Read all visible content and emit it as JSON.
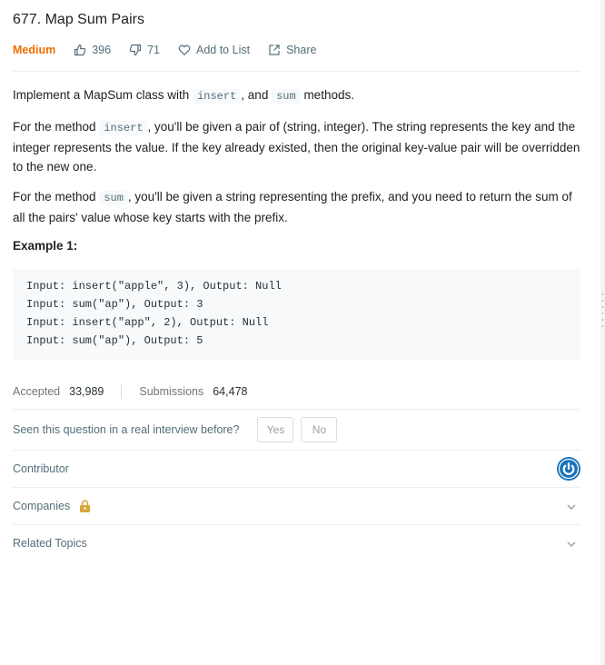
{
  "problem": {
    "title": "677. Map Sum Pairs",
    "difficulty": "Medium",
    "likes": "396",
    "dislikes": "71",
    "add_to_list": "Add to List",
    "share": "Share"
  },
  "description": {
    "p1_a": "Implement a MapSum class with ",
    "p1_code1": "insert",
    "p1_b": ", and ",
    "p1_code2": "sum",
    "p1_c": " methods.",
    "p2_a": "For the method ",
    "p2_code": "insert",
    "p2_b": ", you'll be given a pair of (string, integer). The string represents the key and the integer represents the value. If the key already existed, then the original key-value pair will be overridden to the new one.",
    "p3_a": "For the method ",
    "p3_code": "sum",
    "p3_b": ", you'll be given a string representing the prefix, and you need to return the sum of all the pairs' value whose key starts with the prefix."
  },
  "example": {
    "title": "Example 1:",
    "lines": [
      "Input: insert(\"apple\", 3), Output: Null",
      "Input: sum(\"ap\"), Output: 3",
      "Input: insert(\"app\", 2), Output: Null",
      "Input: sum(\"ap\"), Output: 5"
    ]
  },
  "stats": {
    "accepted_label": "Accepted",
    "accepted_value": "33,989",
    "submissions_label": "Submissions",
    "submissions_value": "64,478"
  },
  "interview": {
    "question": "Seen this question in a real interview before?",
    "yes": "Yes",
    "no": "No"
  },
  "sections": {
    "contributor": "Contributor",
    "companies": "Companies",
    "related_topics": "Related Topics"
  },
  "colors": {
    "difficulty_medium": "#ef6c00",
    "lock": "#d9a43a",
    "contributor_avatar": "#1a73b8"
  }
}
